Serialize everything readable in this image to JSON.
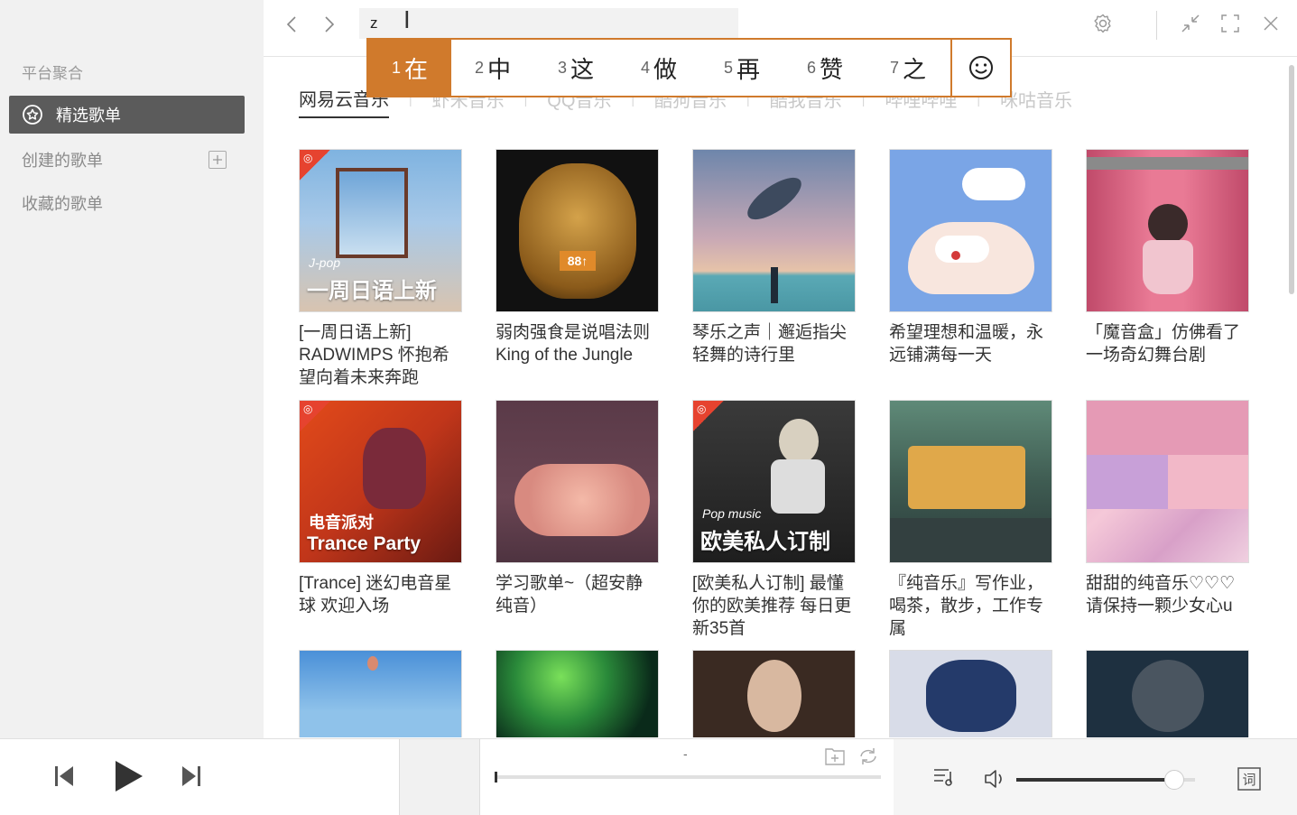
{
  "sidebar": {
    "section_label": "平台聚合",
    "items": [
      {
        "label": "精选歌单",
        "active": true
      },
      {
        "label": "创建的歌单",
        "has_add": true
      },
      {
        "label": "收藏的歌单"
      }
    ]
  },
  "search": {
    "value": "z",
    "placeholder": ""
  },
  "ime": {
    "candidates": [
      {
        "num": "1",
        "text": "在",
        "selected": true
      },
      {
        "num": "2",
        "text": "中"
      },
      {
        "num": "3",
        "text": "这"
      },
      {
        "num": "4",
        "text": "做"
      },
      {
        "num": "5",
        "text": "再"
      },
      {
        "num": "6",
        "text": "赞"
      },
      {
        "num": "7",
        "text": "之"
      }
    ]
  },
  "tabs": [
    "网易云音乐",
    "虾米音乐",
    "QQ音乐",
    "酷狗音乐",
    "酷我音乐",
    "哔哩哔哩",
    "咪咕音乐"
  ],
  "playlists": [
    {
      "title": "[一周日语上新] RADWIMPS 怀抱希望向着未来奔跑",
      "cover_text_small": "J-pop",
      "cover_text_big": "一周日语上新",
      "badge": true
    },
    {
      "title": "弱肉强食是说唱法则 King of the Jungle",
      "cover_text_small": "",
      "cover_text_big": "",
      "badge": false
    },
    {
      "title": "琴乐之声｜邂逅指尖轻舞的诗行里",
      "cover_text_small": "",
      "cover_text_big": "",
      "badge": false
    },
    {
      "title": "希望理想和温暖，永远铺满每一天",
      "cover_text_small": "",
      "cover_text_big": "",
      "badge": false
    },
    {
      "title": "「魔音盒」仿佛看了一场奇幻舞台剧",
      "cover_text_small": "",
      "cover_text_big": "",
      "badge": false
    },
    {
      "title": "[Trance] 迷幻电音星球 欢迎入场",
      "cover_text_small": "电音派对",
      "cover_text_big": "Trance Party",
      "badge": true
    },
    {
      "title": "学习歌单~（超安静纯音）",
      "cover_text_small": "",
      "cover_text_big": "",
      "badge": false
    },
    {
      "title": "[欧美私人订制] 最懂你的欧美推荐 每日更新35首",
      "cover_text_small": "Pop music",
      "cover_text_big": "欧美私人订制",
      "badge": true
    },
    {
      "title": "『纯音乐』写作业，喝茶，散步，工作专属",
      "cover_text_small": "",
      "cover_text_big": "",
      "badge": false
    },
    {
      "title": "甜甜的纯音乐♡♡♡请保持一颗少女心u",
      "cover_text_small": "",
      "cover_text_big": "",
      "badge": false
    },
    {
      "title": "",
      "cover_text_small": "",
      "cover_text_big": "",
      "badge": false
    },
    {
      "title": "",
      "cover_text_small": "",
      "cover_text_big": "",
      "badge": false
    },
    {
      "title": "",
      "cover_text_small": "",
      "cover_text_big": "",
      "badge": false
    },
    {
      "title": "",
      "cover_text_small": "",
      "cover_text_big": "",
      "badge": false
    },
    {
      "title": "",
      "cover_text_small": "",
      "cover_text_big": "",
      "badge": false
    }
  ],
  "player": {
    "track_title": "-",
    "progress": 0,
    "volume": 0.94
  },
  "colors": {
    "accent": "#d07a2c",
    "sidebar_bg": "#f1f1f1",
    "active_item": "#5b5b5b"
  }
}
